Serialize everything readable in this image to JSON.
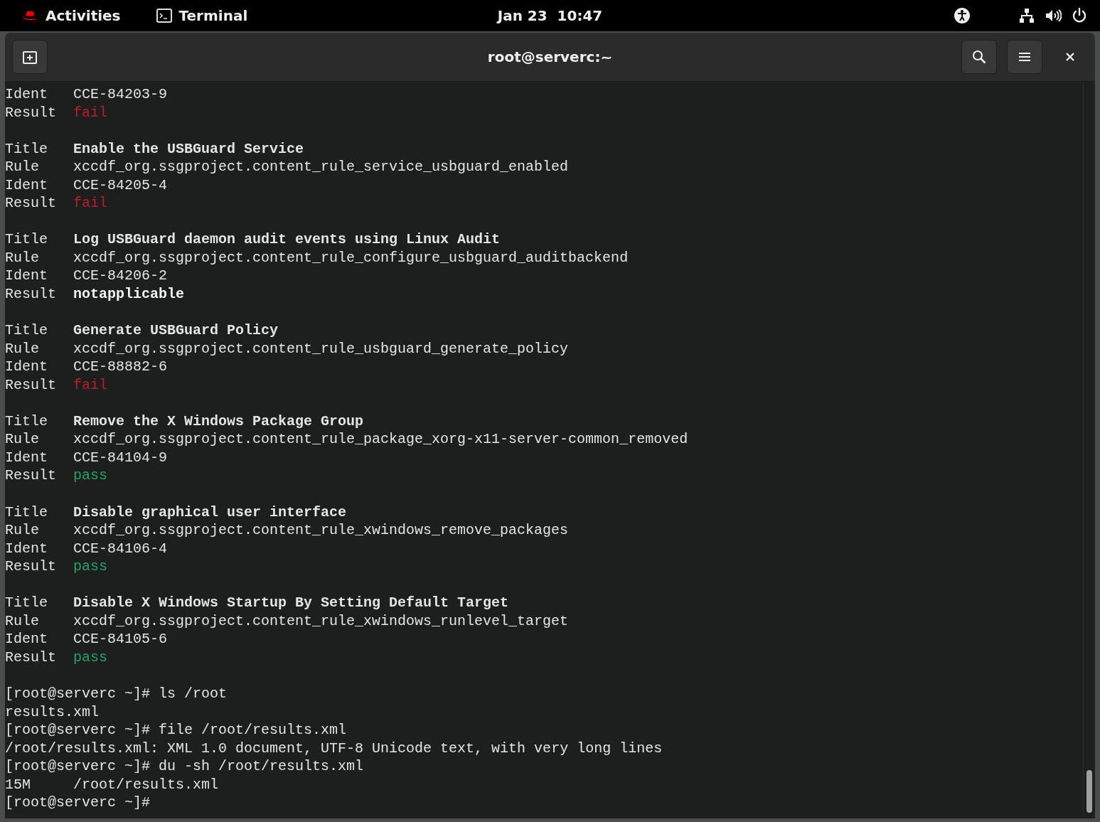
{
  "top_bar": {
    "activities": "Activities",
    "app": "Terminal",
    "clock": "Jan 23  10:47"
  },
  "window": {
    "title": "root@serverc:~"
  },
  "records": [
    {
      "lines": [
        {
          "kind": "field",
          "label": "Ident",
          "value": "CCE-84203-9"
        },
        {
          "kind": "fail",
          "label": "Result",
          "value": "fail"
        }
      ]
    },
    {
      "lines": [
        {
          "kind": "title",
          "label": "Title",
          "value": "Enable the USBGuard Service"
        },
        {
          "kind": "field",
          "label": "Rule",
          "value": "xccdf_org.ssgproject.content_rule_service_usbguard_enabled"
        },
        {
          "kind": "field",
          "label": "Ident",
          "value": "CCE-84205-4"
        },
        {
          "kind": "fail",
          "label": "Result",
          "value": "fail"
        }
      ]
    },
    {
      "lines": [
        {
          "kind": "title",
          "label": "Title",
          "value": "Log USBGuard daemon audit events using Linux Audit"
        },
        {
          "kind": "field",
          "label": "Rule",
          "value": "xccdf_org.ssgproject.content_rule_configure_usbguard_auditbackend"
        },
        {
          "kind": "field",
          "label": "Ident",
          "value": "CCE-84206-2"
        },
        {
          "kind": "notapplicable",
          "label": "Result",
          "value": "notapplicable"
        }
      ]
    },
    {
      "lines": [
        {
          "kind": "title",
          "label": "Title",
          "value": "Generate USBGuard Policy"
        },
        {
          "kind": "field",
          "label": "Rule",
          "value": "xccdf_org.ssgproject.content_rule_usbguard_generate_policy"
        },
        {
          "kind": "field",
          "label": "Ident",
          "value": "CCE-88882-6"
        },
        {
          "kind": "fail",
          "label": "Result",
          "value": "fail"
        }
      ]
    },
    {
      "lines": [
        {
          "kind": "title",
          "label": "Title",
          "value": "Remove the X Windows Package Group"
        },
        {
          "kind": "field",
          "label": "Rule",
          "value": "xccdf_org.ssgproject.content_rule_package_xorg-x11-server-common_removed"
        },
        {
          "kind": "field",
          "label": "Ident",
          "value": "CCE-84104-9"
        },
        {
          "kind": "pass",
          "label": "Result",
          "value": "pass"
        }
      ]
    },
    {
      "lines": [
        {
          "kind": "title",
          "label": "Title",
          "value": "Disable graphical user interface"
        },
        {
          "kind": "field",
          "label": "Rule",
          "value": "xccdf_org.ssgproject.content_rule_xwindows_remove_packages"
        },
        {
          "kind": "field",
          "label": "Ident",
          "value": "CCE-84106-4"
        },
        {
          "kind": "pass",
          "label": "Result",
          "value": "pass"
        }
      ]
    },
    {
      "lines": [
        {
          "kind": "title",
          "label": "Title",
          "value": "Disable X Windows Startup By Setting Default Target"
        },
        {
          "kind": "field",
          "label": "Rule",
          "value": "xccdf_org.ssgproject.content_rule_xwindows_runlevel_target"
        },
        {
          "kind": "field",
          "label": "Ident",
          "value": "CCE-84105-6"
        },
        {
          "kind": "pass",
          "label": "Result",
          "value": "pass"
        }
      ]
    }
  ],
  "shell": [
    {
      "kind": "command",
      "prompt": "[root@serverc ~]#",
      "command": "ls /root"
    },
    {
      "kind": "output",
      "text": "results.xml"
    },
    {
      "kind": "command",
      "prompt": "[root@serverc ~]#",
      "command": "file /root/results.xml"
    },
    {
      "kind": "output",
      "text": "/root/results.xml: XML 1.0 document, UTF-8 Unicode text, with very long lines"
    },
    {
      "kind": "command",
      "prompt": "[root@serverc ~]#",
      "command": "du -sh /root/results.xml"
    },
    {
      "kind": "output",
      "text": "15M     /root/results.xml"
    },
    {
      "kind": "command",
      "prompt": "[root@serverc ~]#"
    }
  ]
}
